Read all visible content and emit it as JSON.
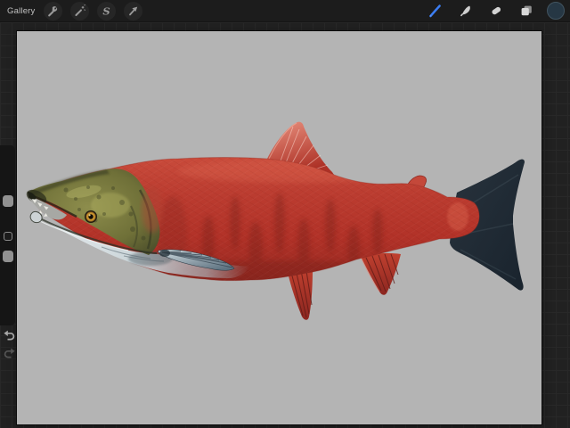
{
  "top_bar": {
    "gallery_label": "Gallery",
    "accent_color": "#3b7df2",
    "current_color": "#263744",
    "left_tools": [
      {
        "name": "actions",
        "icon": "wrench-icon"
      },
      {
        "name": "adjustments",
        "icon": "magic-wand-icon"
      },
      {
        "name": "selection",
        "icon": "selection-s-icon",
        "glyph": "S"
      },
      {
        "name": "transform",
        "icon": "transform-arrow-icon"
      }
    ],
    "right_tools": [
      {
        "name": "paint",
        "icon": "brush-icon",
        "selected": true
      },
      {
        "name": "smudge",
        "icon": "smudge-finger-icon",
        "selected": false
      },
      {
        "name": "erase",
        "icon": "eraser-icon",
        "selected": false
      },
      {
        "name": "layers",
        "icon": "layers-icon",
        "selected": false
      },
      {
        "name": "color",
        "icon": "color-swatch-icon",
        "selected": false
      }
    ]
  },
  "sidebar": {
    "items": [
      "brush-size-slider",
      "modify-button",
      "opacity-slider",
      "undo",
      "redo"
    ]
  },
  "canvas": {
    "background_color": "#b4b4b4",
    "artwork": {
      "subject": "Sockeye salmon painting facing left with open hooked jaws",
      "body_color": "#b5392e",
      "head_color": "#76763c",
      "tail_fin_color": "#1f2933",
      "belly_color": "#ccd6da",
      "eye_color": "#c8932f",
      "fin_color": "#c03d31"
    }
  }
}
